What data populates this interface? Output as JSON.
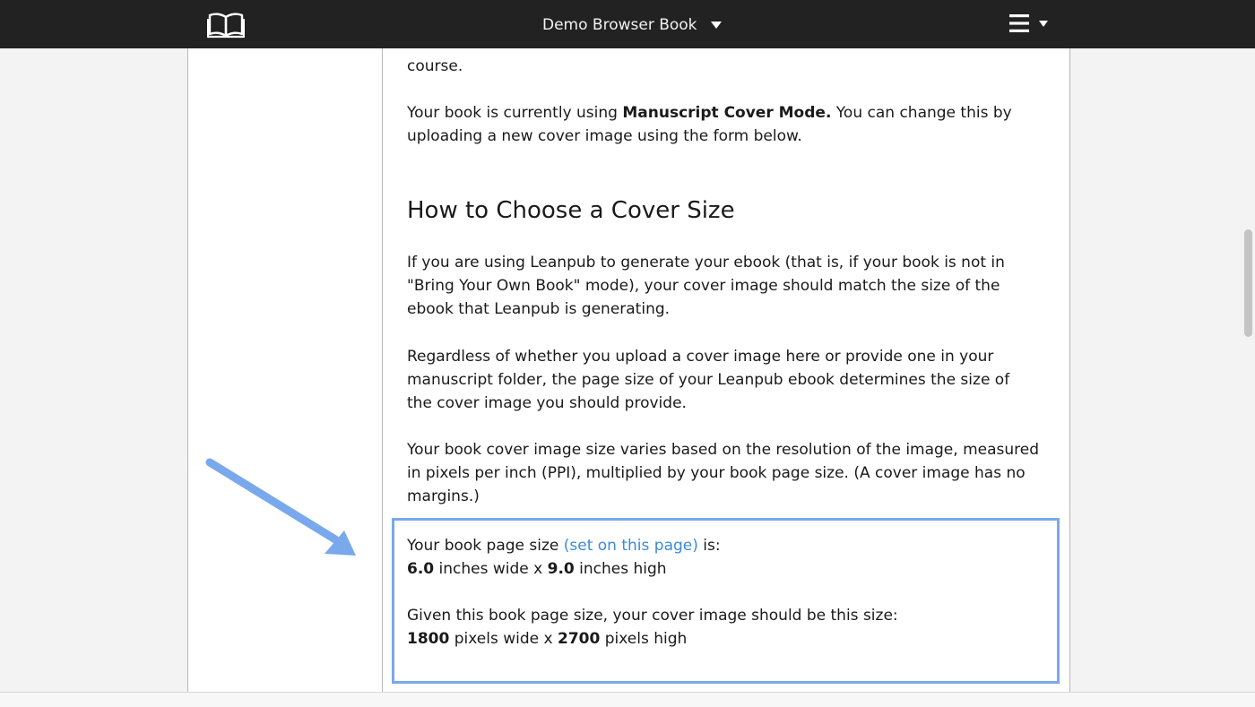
{
  "topbar": {
    "book_title": "Demo Browser Book",
    "icons": {
      "logo": "open-book-icon",
      "title_menu": "caret-down-icon",
      "menu": "hamburger-icon"
    }
  },
  "content": {
    "partial_line": "course.",
    "mode_text_before": "Your book is currently using ",
    "mode_name": "Manuscript Cover Mode.",
    "mode_text_after": " You can change this by uploading a new cover image using the form below.",
    "heading": "How to Choose a Cover Size",
    "par1": "If you are using Leanpub to generate your ebook (that is, if your book is not in \"Bring Your Own Book\" mode), your cover image should match the size of the ebook that Leanpub is generating.",
    "par2": "Regardless of whether you upload a cover image here or provide one in your manuscript folder, the page size of your Leanpub ebook determines the size of the cover image you should provide.",
    "par3": "Your book cover image size varies based on the resolution of the image, measured in pixels per inch (PPI), multiplied by your book page size. (A cover image has no margins.)"
  },
  "size_box": {
    "page_size_before": "Your book page size ",
    "page_size_link": "(set on this page)",
    "page_size_after": " is:",
    "width_inches": "6.0",
    "inches_wide_text": " inches wide x ",
    "height_inches": "9.0",
    "inches_high_text": " inches high",
    "given_text": "Given this book page size, your cover image should be this size:",
    "width_pixels": "1800",
    "pixels_wide_text": " pixels wide x ",
    "height_pixels": "2700",
    "pixels_high_text": " pixels high"
  },
  "colors": {
    "topbar": "#222222",
    "link": "#3b8ad9",
    "highlight_border": "#7aa8ec",
    "arrow": "#7aa8ec"
  }
}
